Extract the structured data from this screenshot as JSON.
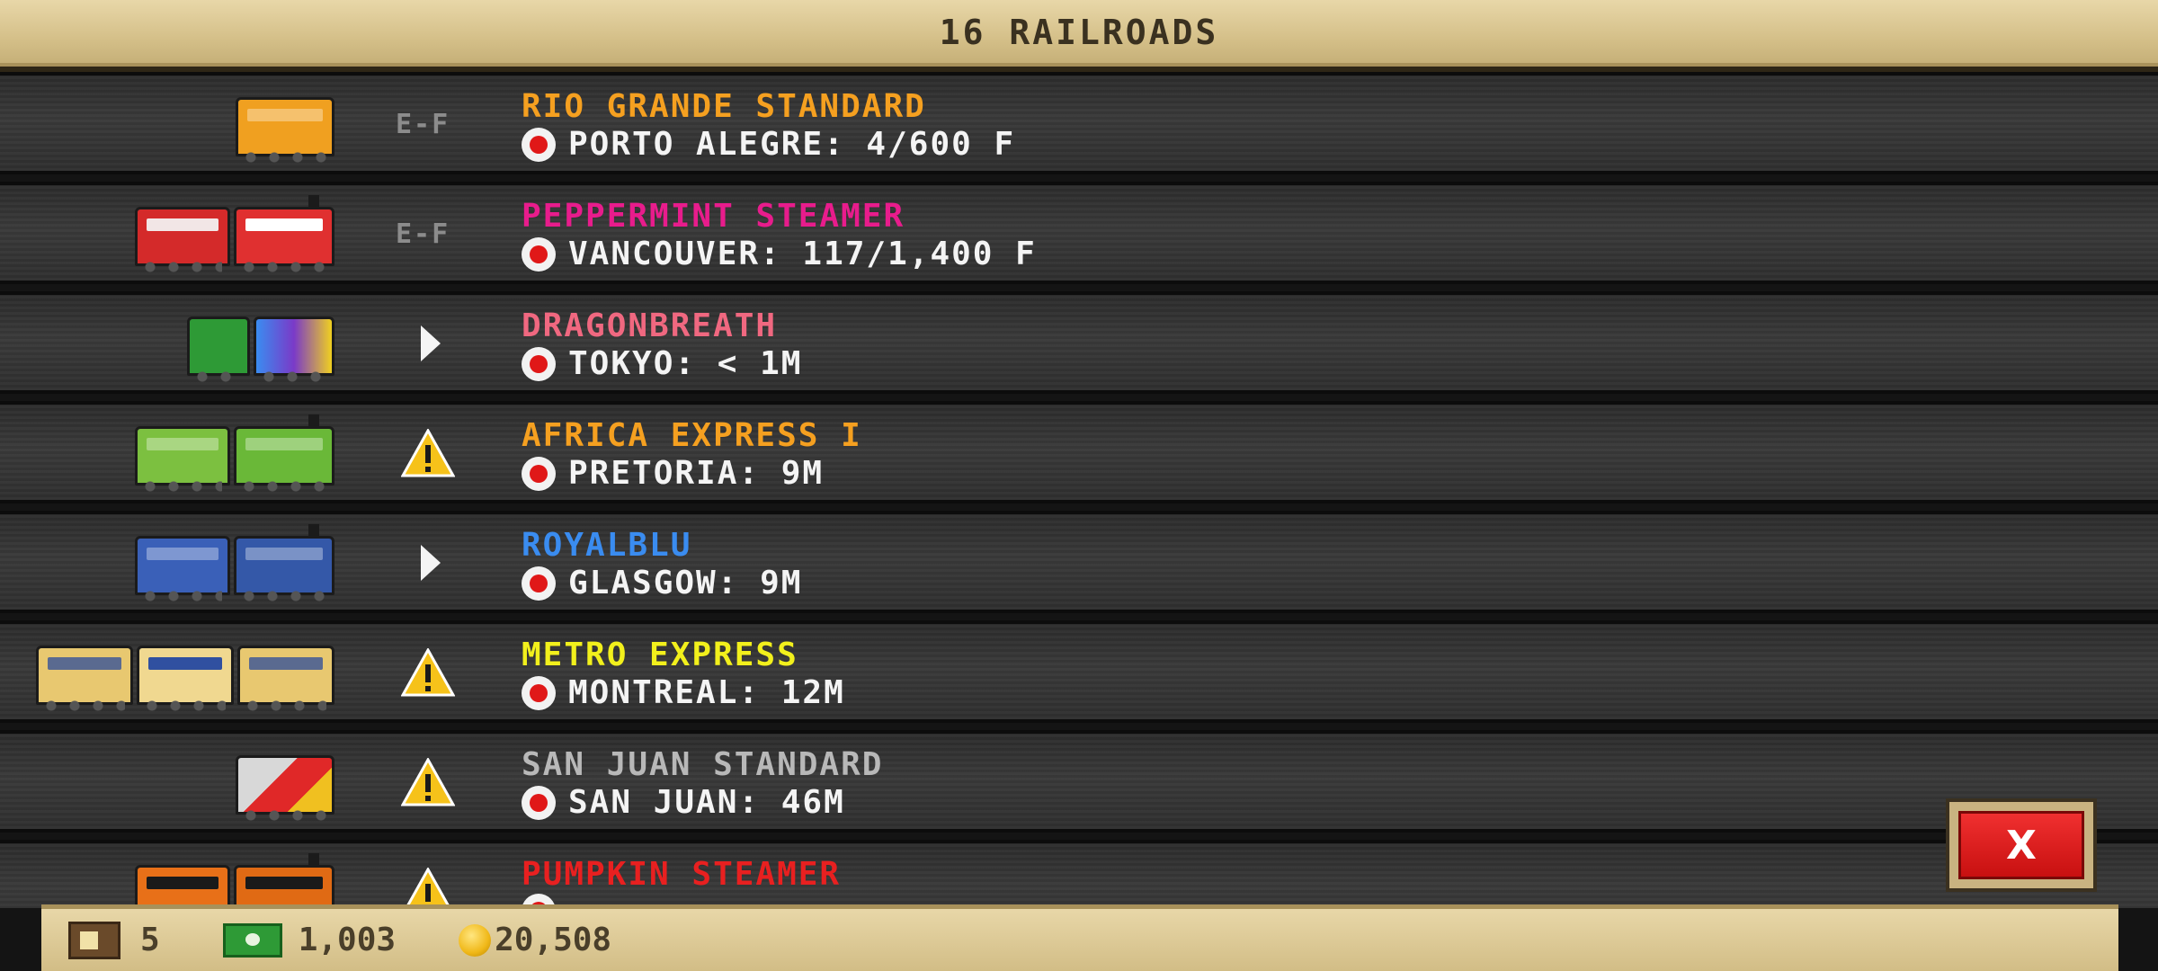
{
  "header": {
    "title": "16 RAILROADS"
  },
  "rows": [
    {
      "name": "RIO GRANDE STANDARD",
      "name_color": "#f5a020",
      "status": "E-F",
      "status_icon": "empty-full-icon",
      "destination": "PORTO ALEGRE: 4/600 F"
    },
    {
      "name": "PEPPERMINT STEAMER",
      "name_color": "#e81c8c",
      "status": "E-F",
      "status_icon": "empty-full-icon",
      "destination": "VANCOUVER: 117/1,400 F"
    },
    {
      "name": "DRAGONBREATH",
      "name_color": "#f06880",
      "status": "",
      "status_icon": "play-icon",
      "destination": "TOKYO: < 1M"
    },
    {
      "name": "AFRICA EXPRESS I",
      "name_color": "#f5a020",
      "status": "",
      "status_icon": "warning-icon",
      "destination": "PRETORIA: 9M"
    },
    {
      "name": "ROYALBLU",
      "name_color": "#3a8cf0",
      "status": "",
      "status_icon": "play-icon",
      "destination": "GLASGOW: 9M"
    },
    {
      "name": "METRO EXPRESS",
      "name_color": "#f2f01c",
      "status": "",
      "status_icon": "warning-icon",
      "destination": "MONTREAL: 12M"
    },
    {
      "name": "SAN JUAN STANDARD",
      "name_color": "#b8b8b8",
      "status": "",
      "status_icon": "warning-icon",
      "destination": "SAN JUAN: 46M"
    },
    {
      "name": "PUMPKIN STEAMER",
      "name_color": "#e82020",
      "status": "",
      "status_icon": "warning-icon",
      "destination": ""
    }
  ],
  "close_button": {
    "label": "X",
    "icon": "close-icon"
  },
  "footer": {
    "crates": "5",
    "bucks": "1,003",
    "coins": "20,508"
  },
  "colors": {
    "header_bg": "#d4bf88",
    "row_bg": "#2f2f2f",
    "close_red": "#e02020"
  }
}
